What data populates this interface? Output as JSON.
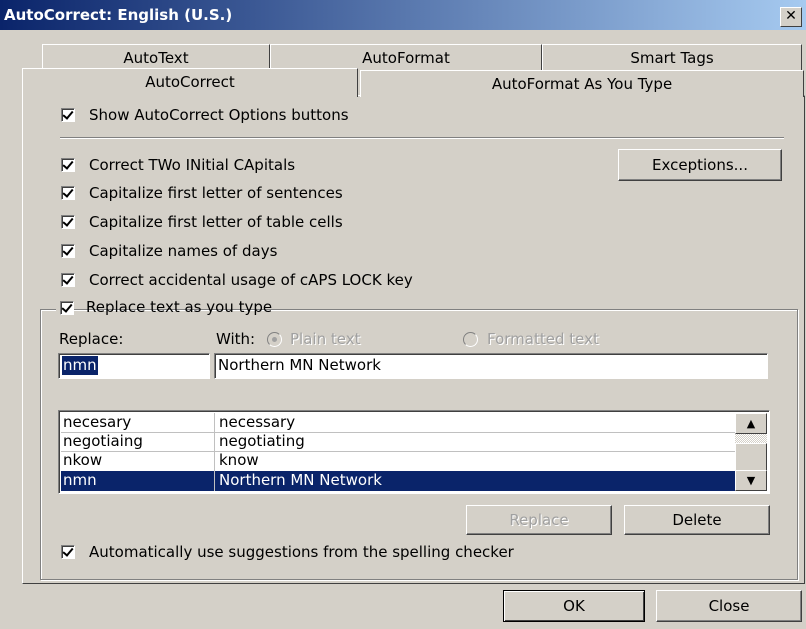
{
  "window": {
    "title": "AutoCorrect: English (U.S.)",
    "close_glyph": "✕"
  },
  "tabs": {
    "back": [
      "AutoText",
      "AutoFormat",
      "Smart Tags"
    ],
    "front": [
      "AutoCorrect",
      "AutoFormat As You Type"
    ]
  },
  "options": {
    "show_buttons": "Show AutoCorrect Options buttons",
    "two_initials": "Correct TWo INitial CApitals",
    "first_letter": "Capitalize first letter of sentences",
    "table_cells": "Capitalize first letter of table cells",
    "days": "Capitalize names of days",
    "caps_lock": "Correct accidental usage of cAPS LOCK key",
    "replace_as_type": "Replace text as you type",
    "spelling_suggest": "Automatically use suggestions from the spelling checker"
  },
  "buttons": {
    "exceptions": "Exceptions...",
    "replace": "Replace",
    "delete": "Delete",
    "ok": "OK",
    "close": "Close"
  },
  "replace": {
    "replace_label": "Replace:",
    "with_label": "With:",
    "plain_text": "Plain text",
    "formatted_text": "Formatted text",
    "replace_value": "nmn",
    "with_value": "Northern MN Network"
  },
  "list": {
    "rows": [
      {
        "from": "necesary",
        "to": "necessary"
      },
      {
        "from": "negotiaing",
        "to": "negotiating"
      },
      {
        "from": "nkow",
        "to": "know"
      },
      {
        "from": "nmn",
        "to": "Northern MN Network"
      }
    ]
  },
  "colors": {
    "title_start": "#0a246a",
    "title_end": "#a6caf0",
    "selection": "#0a246a",
    "face": "#d4d0c8"
  }
}
